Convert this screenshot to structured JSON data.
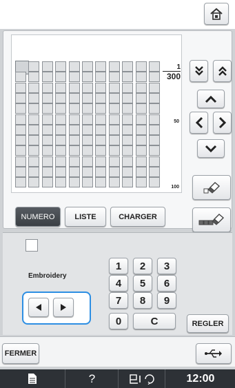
{
  "header": {
    "home_icon": "home-icon"
  },
  "grid": {
    "page_current": "1",
    "page_total": "300",
    "row_mark_mid": "50",
    "row_mark_end": "100"
  },
  "nav": {
    "page_down_icon": "double-chevron-down-icon",
    "page_up_icon": "double-chevron-up-icon",
    "up_icon": "chevron-up-icon",
    "left_icon": "chevron-left-icon",
    "right_icon": "chevron-right-icon",
    "down_icon": "chevron-down-icon",
    "erase_icon": "eraser-icon",
    "erase_all_icon": "eraser-all-icon"
  },
  "tabs": [
    {
      "label": "NUMERO",
      "active": true
    },
    {
      "label": "LISTE",
      "active": false
    },
    {
      "label": "CHARGER",
      "active": false
    }
  ],
  "input": {
    "embroidery_label": "Embroidery",
    "prev_icon": "triangle-left-icon",
    "next_icon": "triangle-right-icon",
    "keys": [
      "1",
      "2",
      "3",
      "4",
      "5",
      "6",
      "7",
      "8",
      "9",
      "0",
      "C"
    ],
    "set_label": "REGLER"
  },
  "footer": {
    "close_label": "FERMER",
    "usb_icon": "usb-icon"
  },
  "status": {
    "help": "?",
    "time": "12:00"
  },
  "colors": {
    "accent_blue": "#2c8ee3",
    "active_tab": "#3b3f44",
    "status_bar": "#2d3136"
  }
}
